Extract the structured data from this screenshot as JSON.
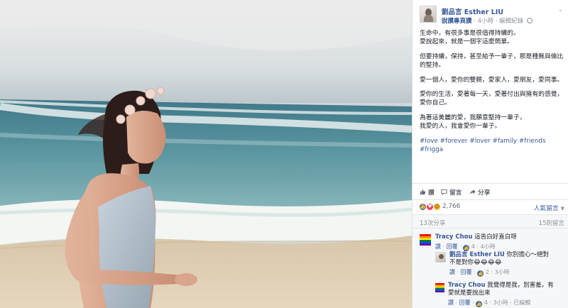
{
  "post": {
    "author": "劉品言 Esther LIU",
    "like_page": "說讚專頁讚",
    "time": "4小時",
    "edit_history": "編輯紀錄",
    "paragraphs": [
      "生命中，有很多事是很值得持續的。\n愛說起來，就是一個字這麼簡單。",
      "但要持續，保持，甚至給予一輩子，那是種無與倫比的堅持。",
      "愛一個人，愛你的雙親，愛家人，愛朋友，愛同事。",
      "愛你的生活，愛著每一天，愛著付出與擁有的感覺，愛你自己。",
      "為著這美麗的愛，我願意堅持一輩子，\n我愛的人，我會愛你一輩子。"
    ],
    "hashtags": [
      "#love",
      "#forever",
      "#lover",
      "#family",
      "#friends",
      "#frigga"
    ]
  },
  "actions": {
    "like": "讚",
    "comment": "留言",
    "share": "分享"
  },
  "reactions": {
    "count": "2,766",
    "order_label": "人氣留言",
    "colors": {
      "like": "#4267b2",
      "love": "#f33e58",
      "haha": "#f7b125"
    }
  },
  "shares": {
    "shares_text": "13次分享",
    "comments_text": "15則留言"
  },
  "comments": [
    {
      "author": "Tracy Chou",
      "text": "這告白好直白呀",
      "like": "讚",
      "reply": "回覆",
      "likes": "4",
      "time": "4小時"
    },
    {
      "author": "劉品言 Esther LIU",
      "text_line1": "你別擔心～絕對",
      "text_line2": "不是對你😂😂😂😂",
      "emoji_tail": "😂😂😂",
      "like": "讚",
      "reply": "回覆",
      "likes": "2",
      "time": "3小時"
    },
    {
      "author": "Tracy Chou",
      "text_line1": "我覺得是我，別害羞。有",
      "text_line2": "愛就是要說出來",
      "like": "讚",
      "reply": "回覆",
      "likes": "4",
      "time": "3小時",
      "edited": "已編輯"
    }
  ]
}
